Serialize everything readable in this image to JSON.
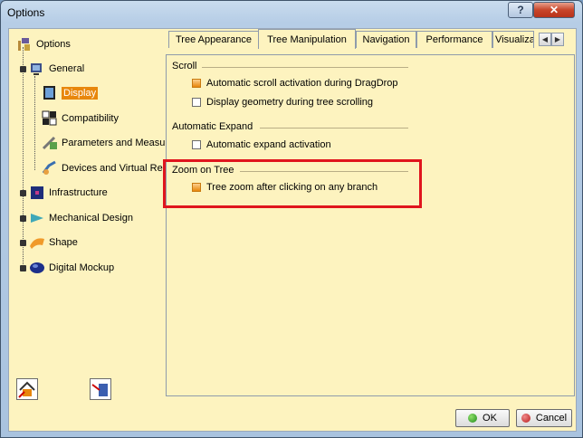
{
  "window": {
    "title": "Options",
    "help_glyph": "?",
    "close_glyph": "✕"
  },
  "tree": {
    "root_label": "Options",
    "items": [
      {
        "label": "General"
      },
      {
        "label": "Display"
      },
      {
        "label": "Compatibility"
      },
      {
        "label": "Parameters and Measure"
      },
      {
        "label": "Devices and Virtual Real"
      },
      {
        "label": "Infrastructure"
      },
      {
        "label": "Mechanical Design"
      },
      {
        "label": "Shape"
      },
      {
        "label": "Digital Mockup"
      }
    ]
  },
  "tabs": [
    {
      "label": "Tree Appearance"
    },
    {
      "label": "Tree Manipulation"
    },
    {
      "label": "Navigation"
    },
    {
      "label": "Performance"
    },
    {
      "label": "Visualizat"
    }
  ],
  "tab_scroll": {
    "left": "◀",
    "right": "▶"
  },
  "sections": {
    "scroll": {
      "title": "Scroll",
      "opt1": "Automatic scroll activation during DragDrop",
      "opt2": "Display geometry during tree scrolling"
    },
    "expand": {
      "title": "Automatic Expand",
      "opt1": "Automatic expand activation"
    },
    "zoom": {
      "title": "Zoom on Tree",
      "opt1": "Tree zoom after clicking on any branch"
    }
  },
  "buttons": {
    "ok": "OK",
    "cancel": "Cancel"
  },
  "colors": {
    "accent": "#e8870c",
    "highlight": "#e0151d",
    "panel_bg": "#fdf3bf"
  }
}
